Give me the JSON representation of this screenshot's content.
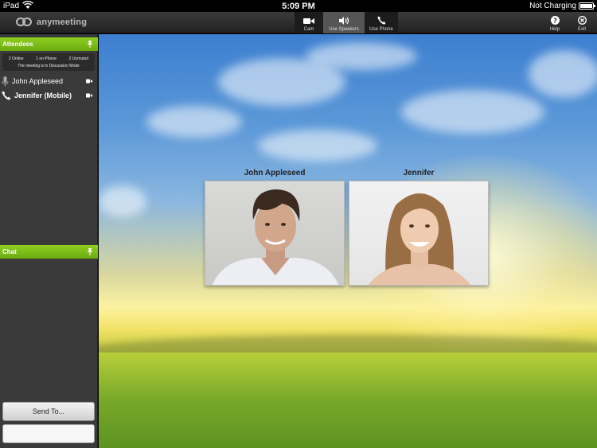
{
  "status_bar": {
    "carrier": "iPad",
    "time": "5:09 PM",
    "charging": "Not Charging"
  },
  "app": {
    "logo_text": "anymeeting"
  },
  "toolbar": {
    "cam_label": "Cam",
    "speakers_label": "Use Speakers",
    "phone_label": "Use Phone",
    "help_label": "Help",
    "exit_label": "Exit"
  },
  "attendees_panel": {
    "title": "Attendees",
    "online": "2 Online",
    "on_phone": "1 on Phone",
    "unmuted": "2 Unmuted",
    "mode": "The meeting is in Discussion Mode",
    "list": [
      {
        "name": "John Appleseed",
        "icon": "microphone-icon"
      },
      {
        "name": "Jennifer (Mobile)",
        "icon": "phone-icon"
      }
    ]
  },
  "chat_panel": {
    "title": "Chat",
    "send_to_label": "Send To...",
    "input_value": ""
  },
  "videos": [
    {
      "label": "John Appleseed"
    },
    {
      "label": "Jennifer"
    }
  ],
  "colors": {
    "accent_green": "#7cc11a",
    "sidebar_bg": "#3a3a3a",
    "toolbar_bg": "#2a2a2a"
  }
}
